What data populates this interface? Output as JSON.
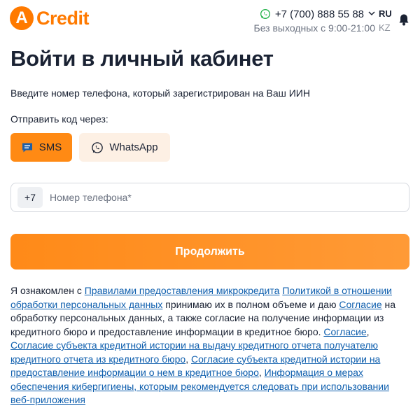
{
  "header": {
    "logo_letter": "A",
    "logo_word": "Credit",
    "phone": "+7 (700) 888 55 88",
    "hours": "Без выходных с 9:00-21:00",
    "lang_active": "RU",
    "lang_other": "KZ",
    "icons": {
      "whatsapp": "whatsapp-icon",
      "chevron": "chevron-down-icon",
      "bell": "bell-icon"
    }
  },
  "main": {
    "title": "Войти в личный кабинет",
    "subtitle": "Введите номер телефона, который зарегистрирован на Ваш ИИН",
    "send_label": "Отправить код через:",
    "sms_label": "SMS",
    "whatsapp_label": "WhatsApp",
    "phone_prefix": "+7",
    "phone_placeholder": "Номер телефона*",
    "phone_value": "",
    "continue_label": "Продолжить"
  },
  "consent": {
    "t1": "Я ознакомлен с ",
    "l1": "Правилами предоставления микрокредита",
    "t2": " ",
    "l2": "Политикой в отношении обработки персональных данных",
    "t3": " принимаю их в полном объеме и даю ",
    "l3": "Согласие",
    "t4": " на обработку персональных данных, а также согласие на получение информации из кредитного бюро и предоставление информации в кредитное бюро. ",
    "l4": "Согласие",
    "t5": ", ",
    "l5": "Согласие субъекта кредитной истории на выдачу кредитного отчета получателю кредитного отчета из кредитного бюро",
    "t6": ", ",
    "l6": "Согласие субъекта кредитной истории на предоставление информации о нем в кредитное бюро",
    "t7": ", ",
    "l7": "Информация о мерах обеспечения кибергигиены, которым рекомендуется следовать при использовании веб-приложения"
  },
  "colors": {
    "accent": "#ff7a00",
    "button": "#ff8a14",
    "link": "#0f5fae",
    "text": "#1a2233"
  }
}
